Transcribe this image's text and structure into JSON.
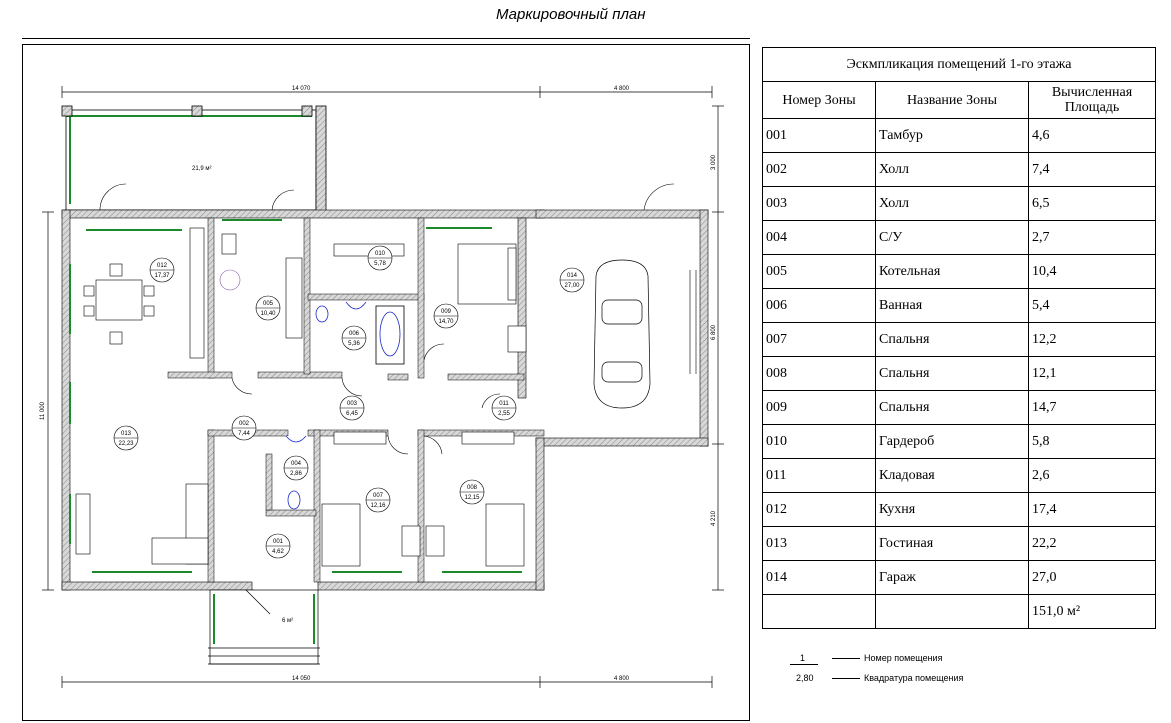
{
  "title": "Маркировочный план",
  "plan": {
    "dims": {
      "top_left": "14 070",
      "top_right": "4 800",
      "bottom_left": "14 050",
      "bottom_right": "4 800",
      "left": "11 000",
      "right_top": "3 000",
      "right_mid": "6 800",
      "right_bot": "4 210"
    },
    "areas": {
      "terrace": "21,9 м²",
      "porch": "6 м²"
    },
    "rooms": [
      {
        "num": "012",
        "area": "17,37"
      },
      {
        "num": "005",
        "area": "10,40"
      },
      {
        "num": "010",
        "area": "5,78"
      },
      {
        "num": "006",
        "area": "5,36"
      },
      {
        "num": "009",
        "area": "14,70"
      },
      {
        "num": "014",
        "area": "27,00"
      },
      {
        "num": "003",
        "area": "6,45"
      },
      {
        "num": "011",
        "area": "2,55"
      },
      {
        "num": "013",
        "area": "22,23"
      },
      {
        "num": "002",
        "area": "7,44"
      },
      {
        "num": "004",
        "area": "2,86"
      },
      {
        "num": "007",
        "area": "12,16"
      },
      {
        "num": "008",
        "area": "12,15"
      },
      {
        "num": "001",
        "area": "4,62"
      }
    ]
  },
  "table": {
    "caption": "Эскмпликация помещений 1-го этажа",
    "headers": [
      "Номер Зоны",
      "Название Зоны",
      "Вычисленная Площадь"
    ],
    "rows": [
      [
        "001",
        "Тамбур",
        "4,6"
      ],
      [
        "002",
        "Холл",
        "7,4"
      ],
      [
        "003",
        "Холл",
        "6,5"
      ],
      [
        "004",
        "С/У",
        "2,7"
      ],
      [
        "005",
        "Котельная",
        "10,4"
      ],
      [
        "006",
        "Ванная",
        "5,4"
      ],
      [
        "007",
        "Спальня",
        "12,2"
      ],
      [
        "008",
        "Спальня",
        "12,1"
      ],
      [
        "009",
        "Спальня",
        "14,7"
      ],
      [
        "010",
        "Гардероб",
        "5,8"
      ],
      [
        "011",
        "Кладовая",
        "2,6"
      ],
      [
        "012",
        "Кухня",
        "17,4"
      ],
      [
        "013",
        "Гостиная",
        "22,2"
      ],
      [
        "014",
        "Гараж",
        "27,0"
      ]
    ],
    "total": "151,0 м²"
  },
  "legend": {
    "num_sample": "1",
    "num_label": "Номер помещения",
    "area_sample": "2,80",
    "area_label": "Квадратура помещения"
  },
  "colors": {
    "wall": "#bdbdbd",
    "window": "#1a8a2a",
    "outline": "#000000"
  }
}
